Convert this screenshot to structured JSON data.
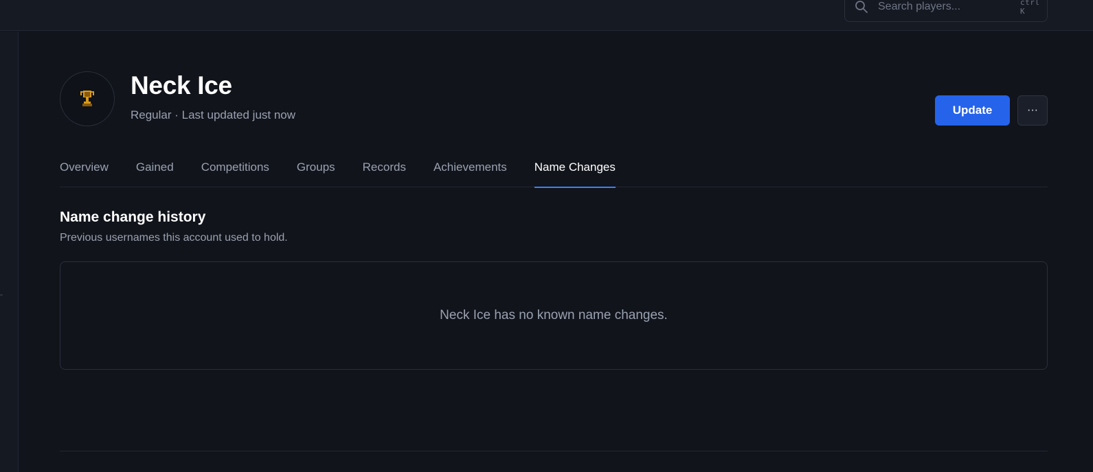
{
  "search": {
    "placeholder": "Search players...",
    "shortcut": "ctrl K"
  },
  "player": {
    "name": "Neck Ice",
    "subtitle": "Regular · Last updated just now",
    "avatar_icon": "trophy-icon"
  },
  "actions": {
    "update_label": "Update",
    "more_label": "···"
  },
  "tabs": [
    {
      "label": "Overview",
      "active": false
    },
    {
      "label": "Gained",
      "active": false
    },
    {
      "label": "Competitions",
      "active": false
    },
    {
      "label": "Groups",
      "active": false
    },
    {
      "label": "Records",
      "active": false
    },
    {
      "label": "Achievements",
      "active": false
    },
    {
      "label": "Name Changes",
      "active": true
    }
  ],
  "section": {
    "title": "Name change history",
    "description": "Previous usernames this account used to hold.",
    "empty_message": "Neck Ice has no known name changes."
  },
  "colors": {
    "accent": "#2563eb",
    "active_tab_underline": "#3b82f6",
    "background": "#11141b"
  }
}
